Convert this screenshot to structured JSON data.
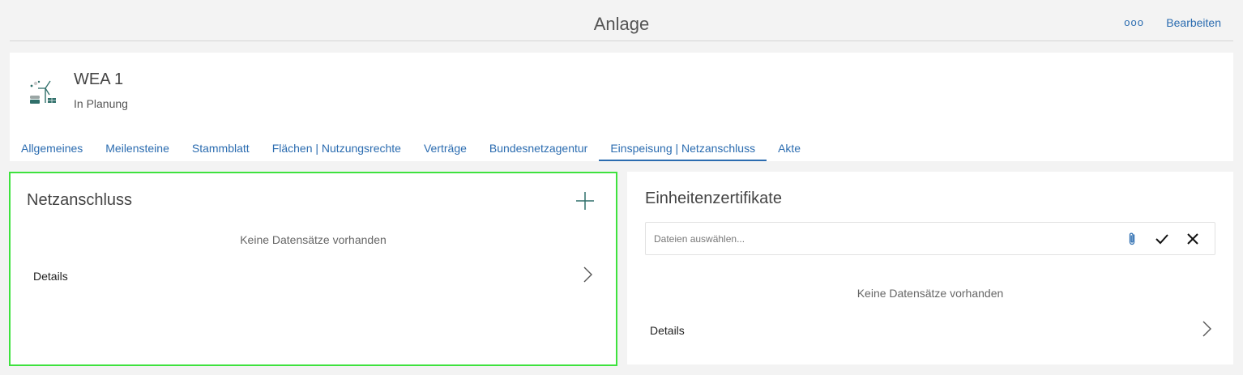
{
  "topbar": {
    "title": "Anlage",
    "more_label": "ooo",
    "edit_label": "Bearbeiten"
  },
  "asset": {
    "name": "WEA 1",
    "status": "In Planung"
  },
  "tabs": [
    {
      "label": "Allgemeines"
    },
    {
      "label": "Meilensteine"
    },
    {
      "label": "Stammblatt"
    },
    {
      "label": "Flächen | Nutzungsrechte"
    },
    {
      "label": "Verträge"
    },
    {
      "label": "Bundesnetzagentur"
    },
    {
      "label": "Einspeisung | Netzanschluss",
      "active": true
    },
    {
      "label": "Akte"
    }
  ],
  "netzanschluss": {
    "title": "Netzanschluss",
    "empty_text": "Keine Datensätze vorhanden",
    "details_label": "Details"
  },
  "einheitenzertifikate": {
    "title": "Einheitenzertifikate",
    "file_placeholder": "Dateien auswählen...",
    "empty_text": "Keine Datensätze vorhanden",
    "details_label": "Details"
  },
  "colors": {
    "accent": "#2b6cb0",
    "highlight_border": "#3ee23e",
    "icon_teal": "#2f6f6a"
  }
}
